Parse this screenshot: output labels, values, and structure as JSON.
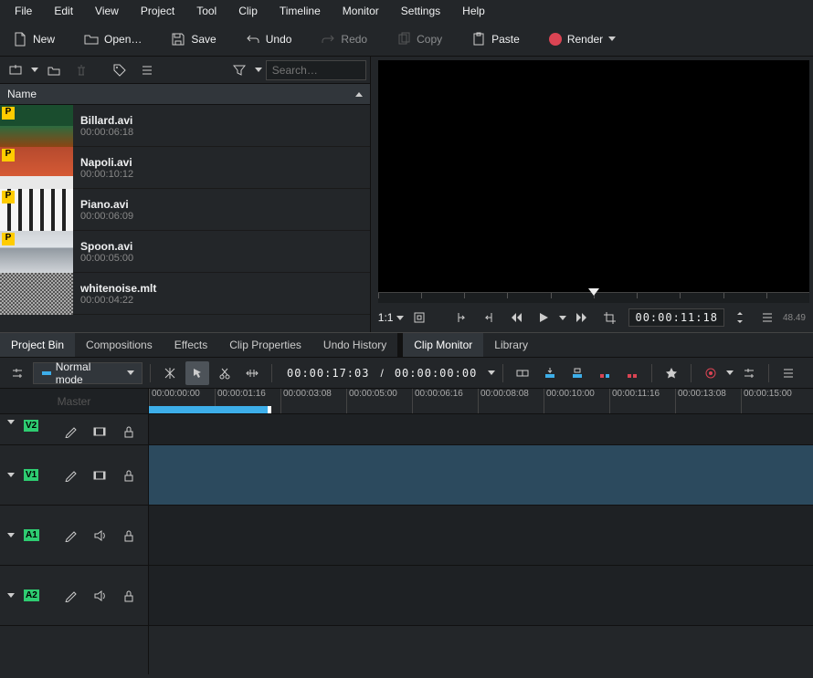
{
  "menu": [
    "File",
    "Edit",
    "View",
    "Project",
    "Tool",
    "Clip",
    "Timeline",
    "Monitor",
    "Settings",
    "Help"
  ],
  "toolbar": {
    "new": "New",
    "open": "Open…",
    "save": "Save",
    "undo": "Undo",
    "redo": "Redo",
    "copy": "Copy",
    "paste": "Paste",
    "render": "Render"
  },
  "bin": {
    "search_ph": "Search…",
    "header": "Name",
    "clips": [
      {
        "name": "Billard.avi",
        "dur": "00:00:06:18",
        "badge": "P",
        "thumb": "billiard"
      },
      {
        "name": "Napoli.avi",
        "dur": "00:00:10:12",
        "badge": "P",
        "thumb": "napoli"
      },
      {
        "name": "Piano.avi",
        "dur": "00:00:06:09",
        "badge": "P",
        "thumb": "piano"
      },
      {
        "name": "Spoon.avi",
        "dur": "00:00:05:00",
        "badge": "P",
        "thumb": "spoon"
      },
      {
        "name": "whitenoise.mlt",
        "dur": "00:00:04:22",
        "badge": "",
        "thumb": "noise"
      }
    ]
  },
  "tabs_left": [
    "Project Bin",
    "Compositions",
    "Effects",
    "Clip Properties",
    "Undo History"
  ],
  "tabs_right": [
    "Clip Monitor",
    "Library"
  ],
  "monitor": {
    "scale": "1:1",
    "timecode": "00:00:11:18",
    "fps": "48.49"
  },
  "timeline": {
    "mode": "Normal mode",
    "tc_current": "00:00:17:03",
    "tc_sep": " / ",
    "tc_total": "00:00:00:00",
    "master": "Master",
    "tracks": [
      {
        "id": "V2",
        "type": "video",
        "short": true
      },
      {
        "id": "V1",
        "type": "video",
        "short": false,
        "highlight": true
      },
      {
        "id": "A1",
        "type": "audio",
        "short": false
      },
      {
        "id": "A2",
        "type": "audio",
        "short": false
      }
    ],
    "ruler": [
      "00:00:00:00",
      "00:00:01:16",
      "00:00:03:08",
      "00:00:05:00",
      "00:00:06:16",
      "00:00:08:08",
      "00:00:10:00",
      "00:00:11:16",
      "00:00:13:08",
      "00:00:15:00"
    ]
  }
}
